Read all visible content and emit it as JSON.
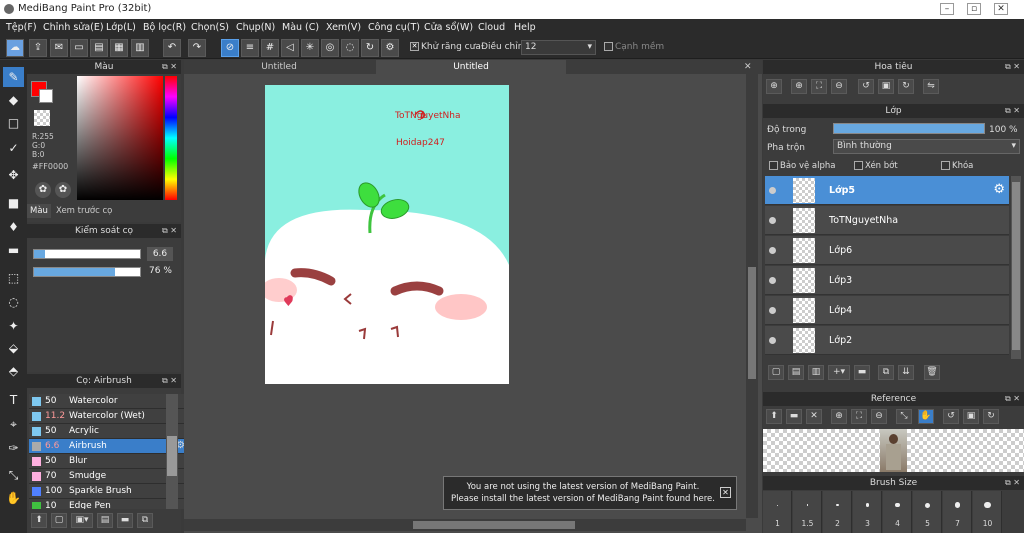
{
  "window": {
    "title": "MediBang Paint Pro (32bit)"
  },
  "menu": [
    "Tệp(F)",
    "Chỉnh sửa(E)",
    "Lớp(L)",
    "Bộ lọc(R)",
    "Chọn(S)",
    "Chụp(N)",
    "Màu (C)",
    "Xem(V)",
    "Công cụ(T)",
    "Cửa sổ(W)",
    "Cloud",
    "Help"
  ],
  "toolbar": {
    "antialias_label": "Khử răng cưa",
    "correction_label": "Điều chỉnh",
    "correction_value": "12",
    "smooth_label": "Cạnh mềm"
  },
  "color_panel": {
    "title": "Màu",
    "r": "R:255",
    "g": "G:0",
    "b": "B:0",
    "hex": "#FF0000",
    "primary_color": "#ff0000",
    "tab_color": "Màu",
    "tab_preview": "Xem trước cọ"
  },
  "brush_control": {
    "title": "Kiểm soát cọ",
    "size_value": "6.6",
    "size_fraction": 0.1,
    "opacity_value": "76 %",
    "opacity_fraction": 0.76
  },
  "brush_panel": {
    "title": "Cọ: Airbrush",
    "items": [
      {
        "size": "50",
        "name": "Watercolor",
        "color": "#7ec8f0"
      },
      {
        "size": "11.2",
        "name": "Watercolor (Wet)",
        "color": "#7ec8f0"
      },
      {
        "size": "50",
        "name": "Acrylic",
        "color": "#7ec8f0"
      },
      {
        "size": "6.6",
        "name": "Airbrush",
        "color": "#aaaaaa"
      },
      {
        "size": "50",
        "name": "Blur",
        "color": "#ffb0e0"
      },
      {
        "size": "70",
        "name": "Smudge",
        "color": "#ffb0e0"
      },
      {
        "size": "100",
        "name": "Sparkle Brush",
        "color": "#5080ff"
      },
      {
        "size": "10",
        "name": "Edge Pen",
        "color": "#40c040"
      }
    ]
  },
  "doc_tabs": [
    "Untitled",
    "Untitled"
  ],
  "canvas": {
    "text_name": "ToTNguyetNha",
    "text_site": "Hoidap247",
    "bg_color": "#8aefe0"
  },
  "notification": {
    "line1": "You are not using the latest version of MediBang Paint.",
    "line2": "Please install the latest version of MediBang Paint found here."
  },
  "navigator": {
    "title": "Hoa tiêu"
  },
  "layer_panel": {
    "title": "Lớp",
    "opacity_label": "Độ trong",
    "opacity_value": "100 %",
    "opacity_fraction": 1.0,
    "blend_label": "Pha trộn",
    "blend_value": "Bình thường",
    "protect_alpha": "Bảo vệ alpha",
    "clipping": "Xén bớt",
    "lock": "Khóa",
    "layers": [
      "Lớp5",
      "ToTNguyetNha",
      "Lớp6",
      "Lớp3",
      "Lớp4",
      "Lớp2"
    ]
  },
  "reference": {
    "title": "Reference"
  },
  "brush_size": {
    "title": "Brush Size",
    "sizes": [
      "1",
      "1.5",
      "2",
      "3",
      "4",
      "5",
      "7",
      "10"
    ]
  }
}
